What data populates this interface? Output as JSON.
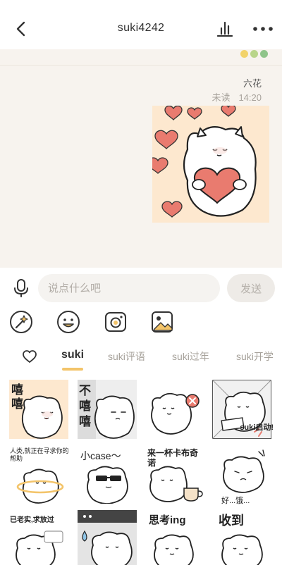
{
  "header": {
    "title": "suki4242",
    "back_icon": "chevron-left-icon",
    "stats_icon": "bar-chart-icon",
    "more_icon": "more-dots-icon"
  },
  "status_dots": [
    "#f2d36b",
    "#b9d58a",
    "#8fc48a"
  ],
  "message": {
    "sender": "六花",
    "read_status": "未读",
    "time": "14:20",
    "sticker": "cat-holding-heart-sticker"
  },
  "input": {
    "placeholder": "说点什么吧",
    "value": "",
    "send_label": "发送",
    "mic_icon": "microphone-icon"
  },
  "tools": [
    "magic-wand-icon",
    "emoji-smile-icon",
    "camera-icon",
    "image-icon"
  ],
  "tabs": {
    "favorites_icon": "heart-icon",
    "items": [
      "suki",
      "suki评语",
      "suki过年",
      "suki开学"
    ],
    "active": "suki"
  },
  "stickers": {
    "row1": [
      "嘻嘻",
      "不嘻嘻",
      "",
      "suki启动!"
    ],
    "row2": [
      "人类,就正在寻求你的帮助",
      "小case～",
      "来一杯卡布奇诺",
      "好...饿..."
    ],
    "row3": [
      "已老实,求放过",
      "",
      "思考ing",
      "收到"
    ]
  },
  "colors": {
    "accent": "#f3c46a",
    "chat_bg": "#f7f3ee",
    "sticker_bg": "#fde8cf",
    "heart": "#e97b6f"
  }
}
